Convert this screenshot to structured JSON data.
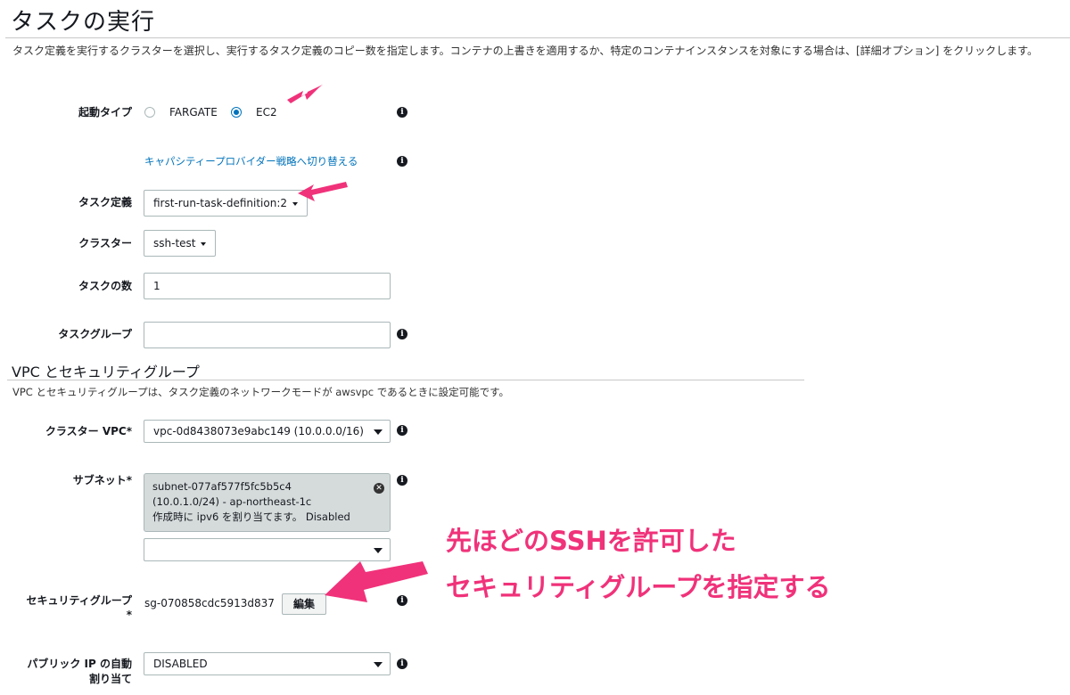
{
  "page": {
    "title": "タスクの実行",
    "description": "タスク定義を実行するクラスターを選択し、実行するタスク定義のコピー数を指定します。コンテナの上書きを適用するか、特定のコンテナインスタンスを対象にする場合は、[詳細オプション] をクリックします。"
  },
  "form": {
    "launch_type": {
      "label": "起動タイプ",
      "options": [
        "FARGATE",
        "EC2"
      ],
      "selected": "EC2"
    },
    "capacity_link": "キャパシティープロバイダー戦略へ切り替える",
    "task_definition": {
      "label": "タスク定義",
      "value": "first-run-task-definition:2"
    },
    "cluster": {
      "label": "クラスター",
      "value": "ssh-test"
    },
    "task_count": {
      "label": "タスクの数",
      "value": "1"
    },
    "task_group": {
      "label": "タスクグループ",
      "value": ""
    }
  },
  "vpc_section": {
    "title": "VPC とセキュリティグループ",
    "description": "VPC とセキュリティグループは、タスク定義のネットワークモードが awsvpc であるときに設定可能です。",
    "cluster_vpc": {
      "label": "クラスター VPC*",
      "value": "vpc-0d8438073e9abc149 (10.0.0.0/16)"
    },
    "subnets": {
      "label": "サブネット*",
      "token_lines": [
        "subnet-077af577f5fc5b5c4",
        "(10.0.1.0/24) - ap-northeast-1c",
        "作成時に ipv6 を割り当てます。 Disabled"
      ],
      "select_value": ""
    },
    "security_group": {
      "label": "セキュリティグループ",
      "required_mark": "*",
      "value": "sg-070858cdc5913d837",
      "edit_label": "編集"
    },
    "public_ip": {
      "label_line1": "パブリック IP の自動",
      "label_line2": "割り当て",
      "value": "DISABLED"
    }
  },
  "annotation": {
    "line1": "先ほどのSSHを許可した",
    "line2": "セキュリティグループを指定する"
  },
  "colors": {
    "accent": "#0073bb",
    "annotation": "#f0327a",
    "border": "#aab7b8"
  }
}
